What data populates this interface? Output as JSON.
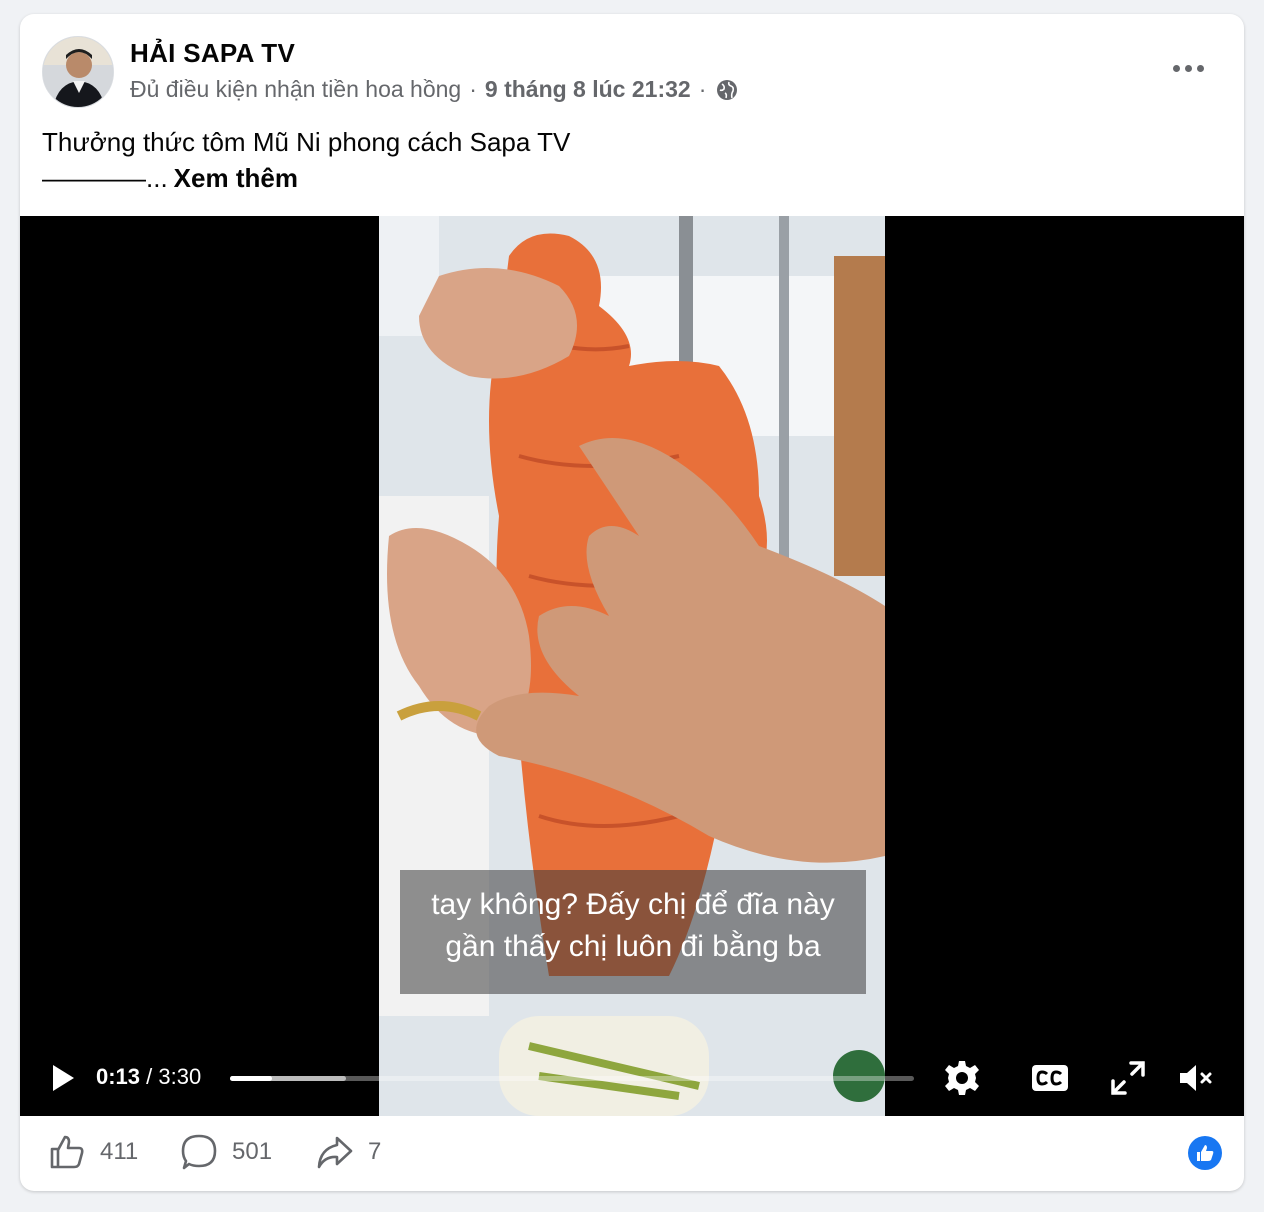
{
  "post": {
    "author": "HẢI SAPA TV",
    "status": "Đủ điều kiện nhận tiền hoa hồng",
    "separator": "·",
    "date": "9 tháng 8 lúc 21:32",
    "audience_icon": "globe-icon",
    "caption_line1": "Thưởng thức tôm Mũ Ni phong cách Sapa TV",
    "caption_line2": "————...",
    "see_more": "Xem thêm"
  },
  "video": {
    "subtitle_line1": "tay không? Đấy chị để đĩa này",
    "subtitle_line2": "gần thấy chị luôn đi bằng ba",
    "current_time": "0:13",
    "time_separator": "/",
    "duration": "3:30",
    "played_fraction": 0.062,
    "buffered_fraction": 0.17,
    "icons": [
      "play-icon",
      "settings-gear-icon",
      "closed-captions-icon",
      "fullscreen-icon",
      "muted-speaker-icon"
    ]
  },
  "actions": {
    "likes": "411",
    "comments": "501",
    "shares": "7"
  },
  "colors": {
    "accent": "#1877f2",
    "secondary_text": "#65676b",
    "background": "#f0f2f5"
  }
}
